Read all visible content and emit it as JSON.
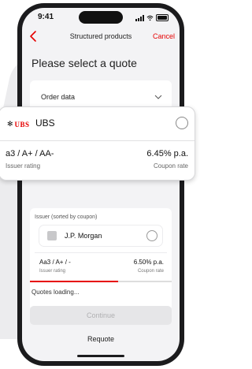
{
  "status_bar": {
    "time": "9:41"
  },
  "nav": {
    "title": "Structured products",
    "cancel_label": "Cancel"
  },
  "heading": "Please select a quote",
  "order_data": {
    "label": "Order data"
  },
  "selected_quote": {
    "logo_text": "UBS",
    "issuer_name": "UBS",
    "rating": "a3 / A+ / AA-",
    "rating_label": "Issuer rating",
    "coupon": "6.45% p.a.",
    "coupon_label": "Coupon rate"
  },
  "issuer_list": {
    "header": "Issuer (sorted by coupon)",
    "items": [
      {
        "issuer_name": "J.P. Morgan",
        "rating": "Aa3 / A+ / -",
        "rating_label": "Issuer rating",
        "coupon": "6.50% p.a.",
        "coupon_label": "Coupon rate"
      }
    ]
  },
  "loading": {
    "text": "Quotes loading...",
    "progress": 0.62
  },
  "buttons": {
    "continue_label": "Continue",
    "requote_label": "Requote"
  },
  "colors": {
    "accent": "#e60000",
    "background": "#f3f3f5"
  }
}
